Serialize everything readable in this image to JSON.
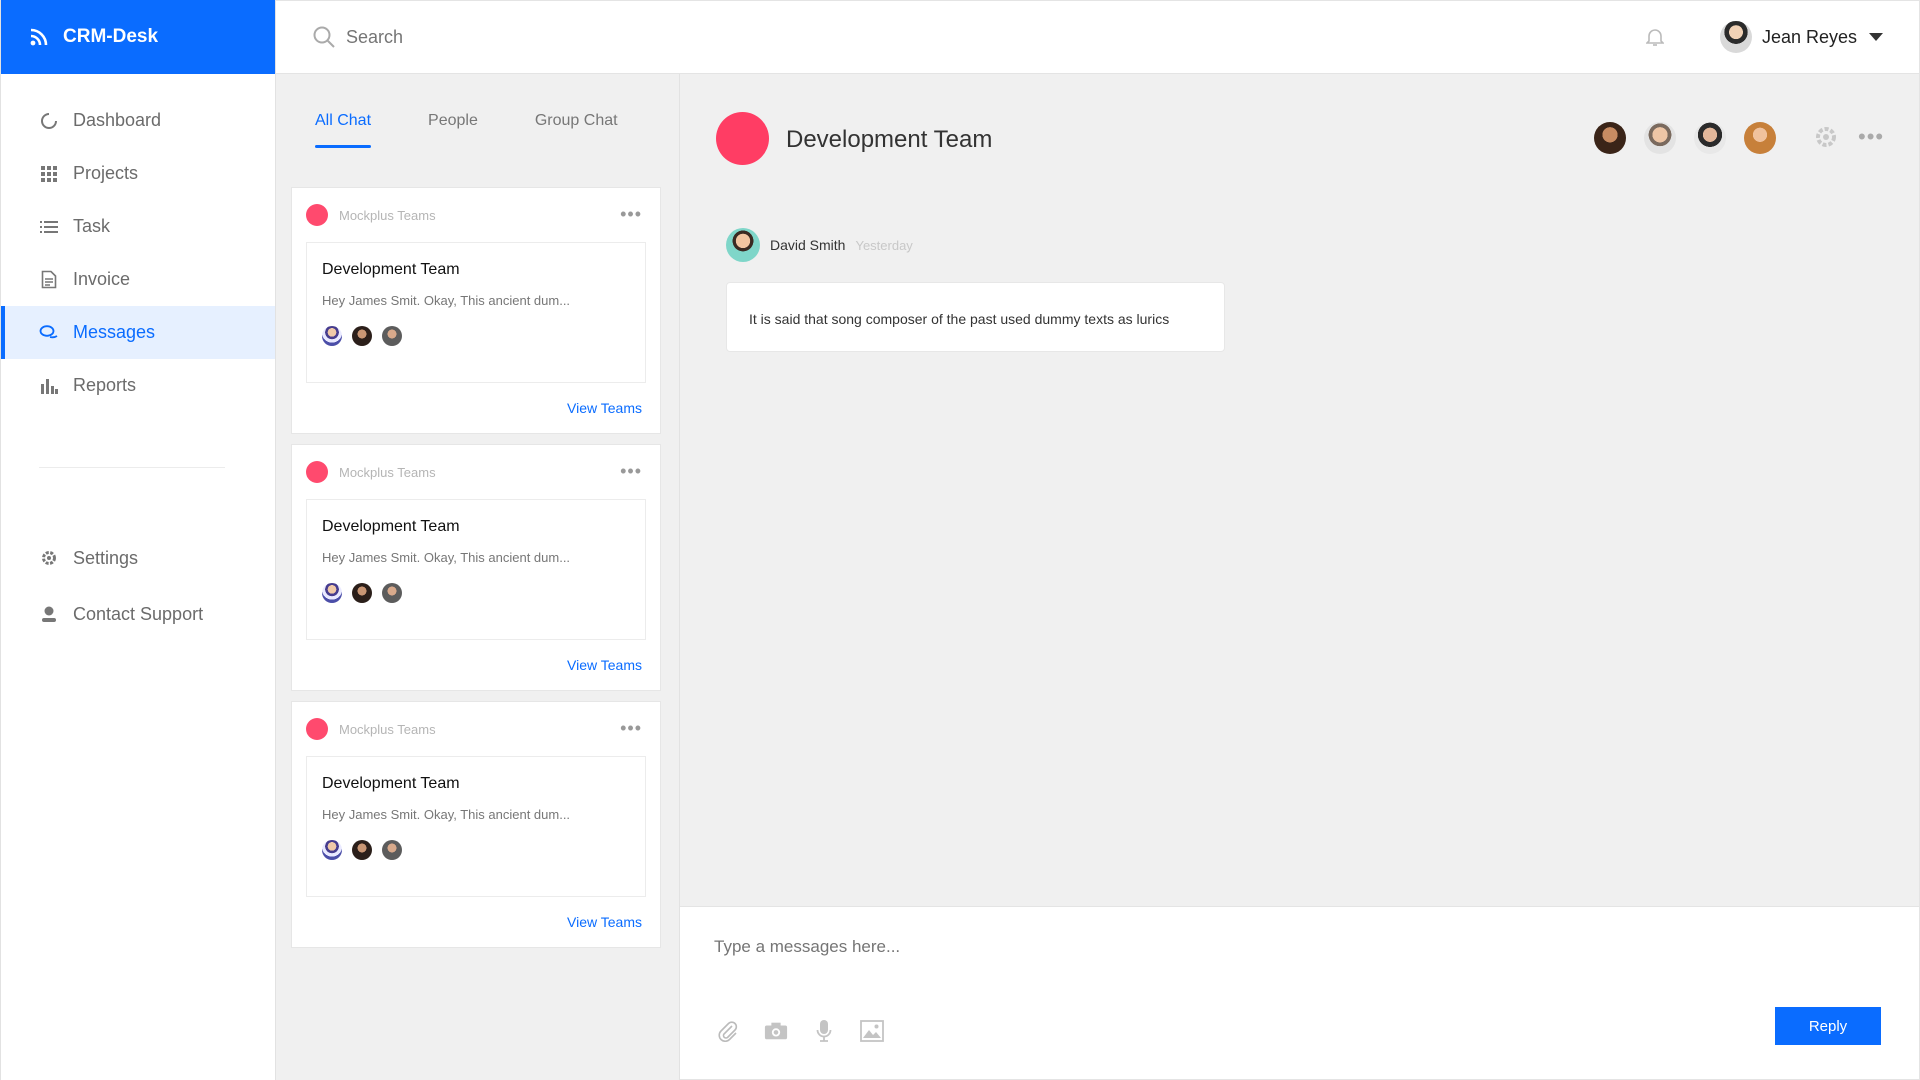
{
  "brand": {
    "name": "CRM-Desk",
    "color": "#0a6cff"
  },
  "sidebar": {
    "items": [
      {
        "label": "Dashboard",
        "icon": "dashboard-icon"
      },
      {
        "label": "Projects",
        "icon": "grid-icon"
      },
      {
        "label": "Task",
        "icon": "list-icon"
      },
      {
        "label": "Invoice",
        "icon": "document-icon"
      },
      {
        "label": "Messages",
        "icon": "chat-icon",
        "active": true
      },
      {
        "label": "Reports",
        "icon": "bar-chart-icon"
      }
    ],
    "bottom_items": [
      {
        "label": "Settings",
        "icon": "gear-icon"
      },
      {
        "label": "Contact Support",
        "icon": "person-icon"
      }
    ]
  },
  "topbar": {
    "search_placeholder": "Search",
    "user_name": "Jean Reyes"
  },
  "chat_list": {
    "tabs": [
      {
        "label": "All Chat",
        "active": true
      },
      {
        "label": "People"
      },
      {
        "label": "Group Chat"
      }
    ],
    "cards": [
      {
        "source": "Mockplus Teams",
        "title": "Development Team",
        "preview": "Hey James Smit. Okay, This ancient dum...",
        "link": "View Teams"
      },
      {
        "source": "Mockplus Teams",
        "title": "Development Team",
        "preview": "Hey James Smit. Okay, This ancient dum...",
        "link": "View Teams"
      },
      {
        "source": "Mockplus Teams",
        "title": "Development Team",
        "preview": "Hey James Smit. Okay, This ancient dum...",
        "link": "View Teams"
      }
    ]
  },
  "chat": {
    "title": "Development Team",
    "accent": "#ff3d64",
    "message": {
      "sender": "David Smith",
      "time": "Yesterday",
      "text": "It is said that song composer of the past used dummy texts as lurics"
    }
  },
  "composer": {
    "placeholder": "Type a messages here...",
    "reply_label": "Reply"
  }
}
